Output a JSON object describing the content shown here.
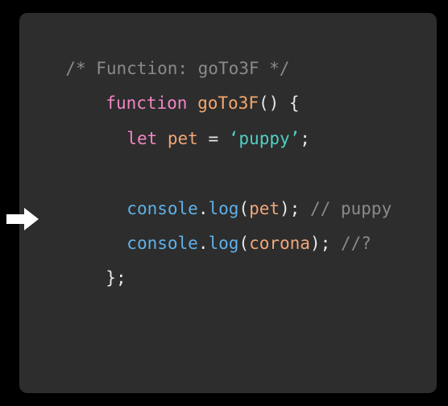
{
  "colors": {
    "background": "#000000",
    "panel": "#2d2d2d",
    "comment": "#8a8a8a",
    "keyword": "#f286c4",
    "function_name": "#f5a76b",
    "default_text": "#e8e8e8",
    "string": "#4fd1c5",
    "builtin": "#5fb0e8",
    "variable": "#f0a77a",
    "inline_comment": "#8a8a8a",
    "arrow": "#ffffff"
  },
  "arrow": {
    "icon": "right-arrow-icon"
  },
  "code": {
    "line1": {
      "comment": "/* Function: goTo3F */"
    },
    "line2": {
      "keyword": "function",
      "space": " ",
      "name": "goTo3F",
      "rest": "() {"
    },
    "line3": {
      "keyword": "let",
      "space1": " ",
      "var": "pet",
      "eq": " = ",
      "str": "‘puppy’",
      "semi": ";"
    },
    "line5": {
      "obj": "console",
      "dot": ".",
      "method": "log",
      "open": "(",
      "arg": "pet",
      "close": ");",
      "space": " ",
      "comment": "// puppy"
    },
    "line6": {
      "obj": "console",
      "dot": ".",
      "method": "log",
      "open": "(",
      "arg": "corona",
      "close": ");",
      "space": " ",
      "comment": "//?"
    },
    "line7": {
      "text": "};"
    }
  }
}
